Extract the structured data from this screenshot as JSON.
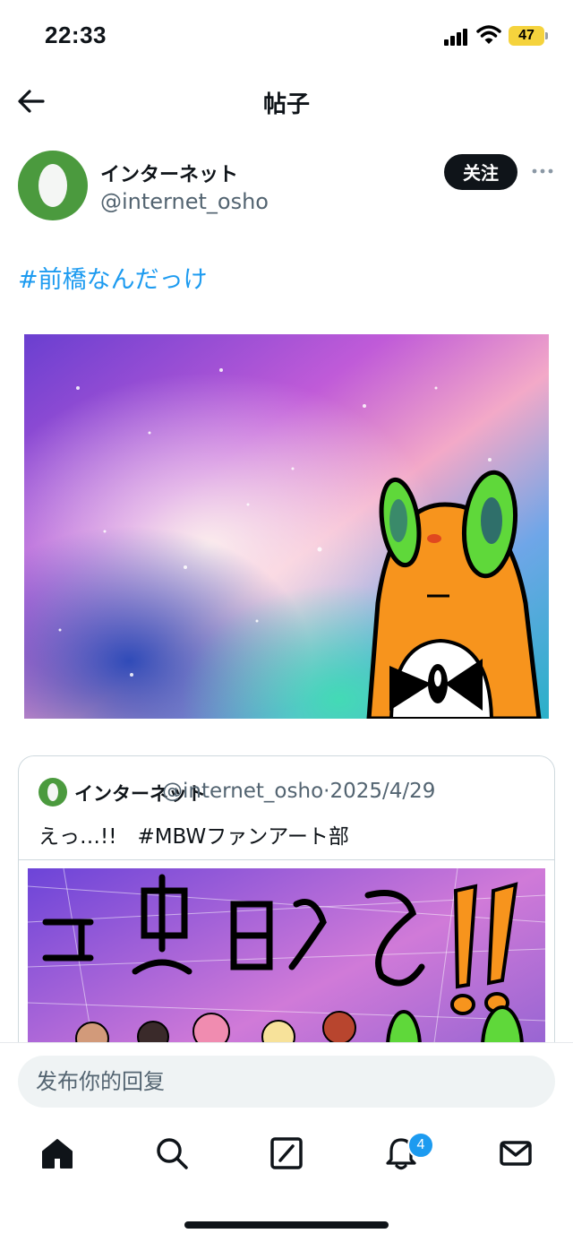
{
  "status_bar": {
    "time": "22:33",
    "battery": "47",
    "icons": [
      "signal-icon",
      "wifi-icon",
      "battery-icon"
    ]
  },
  "header": {
    "title": "帖子",
    "back_icon": "arrow-left-icon"
  },
  "author": {
    "name": "インターネット",
    "handle": "@internet_osho",
    "follow_label": "关注",
    "more_icon": "more-horizontal-icon"
  },
  "post": {
    "hashtag": "#前橋なんだっけ"
  },
  "quote": {
    "name": "インターネット",
    "handle": "@internet_osho",
    "date": "2025/4/29",
    "separator": "·",
    "text": "えっ…!!　#MBWファンアート部"
  },
  "reply": {
    "placeholder": "发布你的回复"
  },
  "nav": {
    "items": [
      "home-icon",
      "search-icon",
      "compose-icon",
      "notifications-icon",
      "messages-icon"
    ],
    "notification_count": "4"
  },
  "colors": {
    "accent": "#1d9bf0",
    "text": "#0f1419",
    "muted": "#536471"
  }
}
